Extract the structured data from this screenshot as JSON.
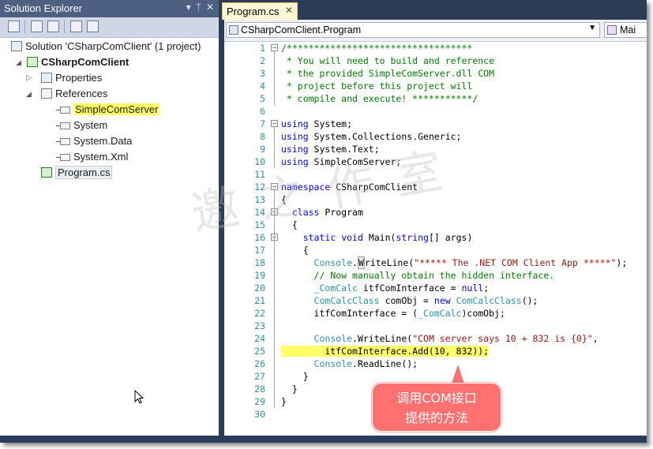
{
  "solution_explorer": {
    "title": "Solution Explorer",
    "pin_icon": "pin-icon",
    "close_label": "✕",
    "dropdown_label": "▾",
    "pin_label": "ᛘ",
    "tree": {
      "solution": "Solution 'CSharpComClient' (1 project)",
      "project": "CSharpComClient",
      "properties": "Properties",
      "references": "References",
      "ref_items": [
        "SimpleComServer",
        "System",
        "System.Data",
        "System.Xml"
      ],
      "file": "Program.cs"
    }
  },
  "editor": {
    "tab_label": "Program.cs",
    "tab_close": "✕",
    "nav_left": "CSharpComClient.Program",
    "nav_right": "Mai",
    "lines": [
      {
        "n": "1",
        "t": "/**********************************"
      },
      {
        "n": "2",
        "t": " * You will need to build and reference"
      },
      {
        "n": "3",
        "t": " * the provided SimpleComServer.dll COM"
      },
      {
        "n": "4",
        "t": " * project before this project will"
      },
      {
        "n": "5",
        "t": " * compile and execute! ***********/"
      },
      {
        "n": "6",
        "t": ""
      },
      {
        "n": "7",
        "t": "using System;"
      },
      {
        "n": "8",
        "t": "using System.Collections.Generic;"
      },
      {
        "n": "9",
        "t": "using System.Text;"
      },
      {
        "n": "10",
        "t": "using SimpleComServer;"
      },
      {
        "n": "11",
        "t": ""
      },
      {
        "n": "12",
        "t": "namespace CSharpComClient"
      },
      {
        "n": "13",
        "t": "{"
      },
      {
        "n": "14",
        "t": "  class Program"
      },
      {
        "n": "15",
        "t": "  {"
      },
      {
        "n": "16",
        "t": "    static void Main(string[] args)"
      },
      {
        "n": "17",
        "t": "    {"
      },
      {
        "n": "18",
        "t": "      Console.WriteLine(\"***** The .NET COM Client App *****\");"
      },
      {
        "n": "19",
        "t": "      // Now manually obtain the hidden interface."
      },
      {
        "n": "20",
        "t": "      _ComCalc itfComInterface = null;"
      },
      {
        "n": "21",
        "t": "      ComCalcClass comObj = new ComCalcClass();"
      },
      {
        "n": "22",
        "t": "      itfComInterface = (_ComCalc)comObj;"
      },
      {
        "n": "23",
        "t": ""
      },
      {
        "n": "24",
        "t": "      Console.WriteLine(\"COM server says 10 + 832 is {0}\","
      },
      {
        "n": "25",
        "t": "        itfComInterface.Add(10, 832));"
      },
      {
        "n": "26",
        "t": "      Console.ReadLine();"
      },
      {
        "n": "27",
        "t": "    }"
      },
      {
        "n": "28",
        "t": "  }"
      },
      {
        "n": "29",
        "t": "}"
      },
      {
        "n": "30",
        "t": ""
      }
    ]
  },
  "watermark": "邀 之 作 室",
  "callout": {
    "line1": "调用COM接口",
    "line2": "提供的方法"
  },
  "colors": {
    "keyword": "#0000ff",
    "comment": "#008000",
    "string": "#a31515",
    "type": "#2b91af",
    "highlight": "#ffff66",
    "callout": "#ff7070"
  }
}
